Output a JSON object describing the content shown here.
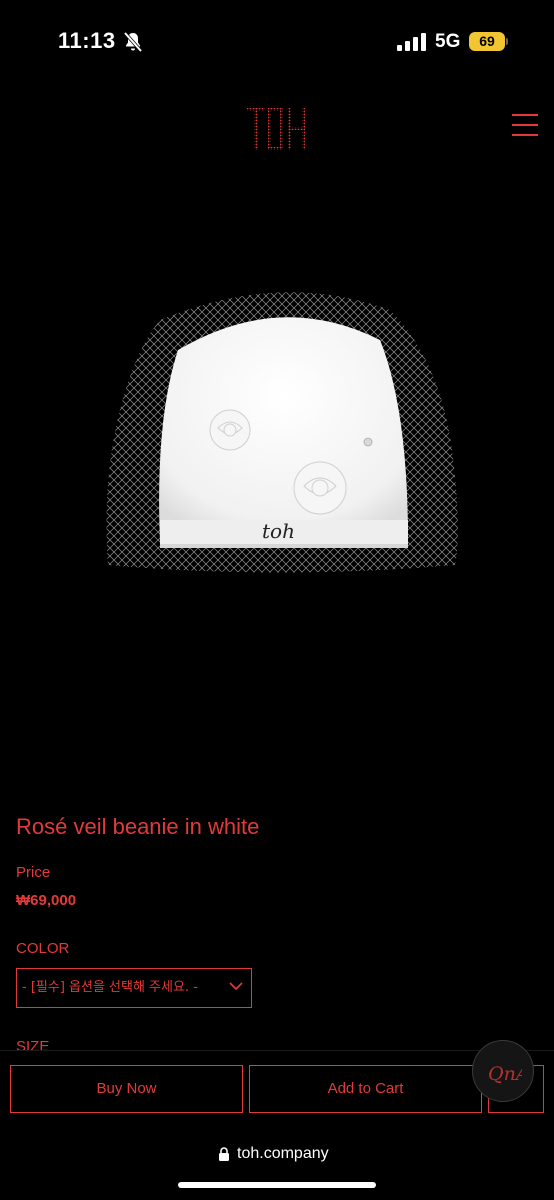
{
  "status_bar": {
    "time": "11:13",
    "network": "5G",
    "battery": "69"
  },
  "header": {
    "logo_text": "TOH",
    "menu_icon": "hamburger-menu-icon"
  },
  "product": {
    "image_icon": "rose-veil-beanie-image",
    "title": "Rosé veil beanie in white",
    "price_label": "Price",
    "price": "₩69,000",
    "color_label": "COLOR",
    "color_select_value": "- [필수] 옵션을 선택해 주세요. -",
    "size_label": "SIZE"
  },
  "actions": {
    "buy_now": "Buy Now",
    "add_to_cart": "Add to Cart",
    "qna_text": "QnA"
  },
  "browser": {
    "url": "toh.company"
  },
  "colors": {
    "accent": "#e23a3a",
    "background": "#000000",
    "battery": "#f2c630"
  }
}
